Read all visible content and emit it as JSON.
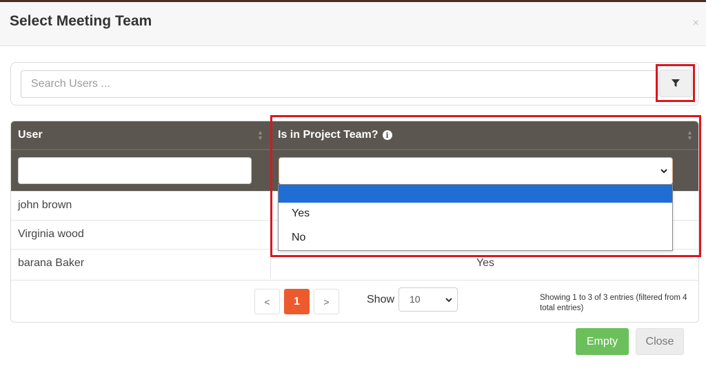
{
  "dialog": {
    "title": "Select Meeting Team",
    "close_symbol": "×"
  },
  "search": {
    "placeholder": "Search Users ..."
  },
  "table": {
    "columns": [
      {
        "label": "User"
      },
      {
        "label": "Is in Project Team?"
      }
    ],
    "rows": [
      {
        "user": "john brown",
        "in_team": ""
      },
      {
        "user": "Virginia wood",
        "in_team": ""
      },
      {
        "user": "barana Baker",
        "in_team": "Yes"
      }
    ]
  },
  "team_filter": {
    "selected": "",
    "options": [
      "",
      "Yes",
      "No"
    ]
  },
  "pagination": {
    "prev": "<",
    "current": "1",
    "next": ">"
  },
  "page_size": {
    "label": "Show",
    "value": "10"
  },
  "entries_info": "Showing 1 to 3 of 3 entries (filtered from 4 total entries)",
  "buttons": {
    "empty": "Empty",
    "close": "Close"
  },
  "colors": {
    "header_dark": "#5b5650",
    "highlight_border": "#d9171e",
    "active_page": "#ed5a2d",
    "empty_button": "#6cc05b",
    "dropdown_selected": "#1f6dd5"
  }
}
